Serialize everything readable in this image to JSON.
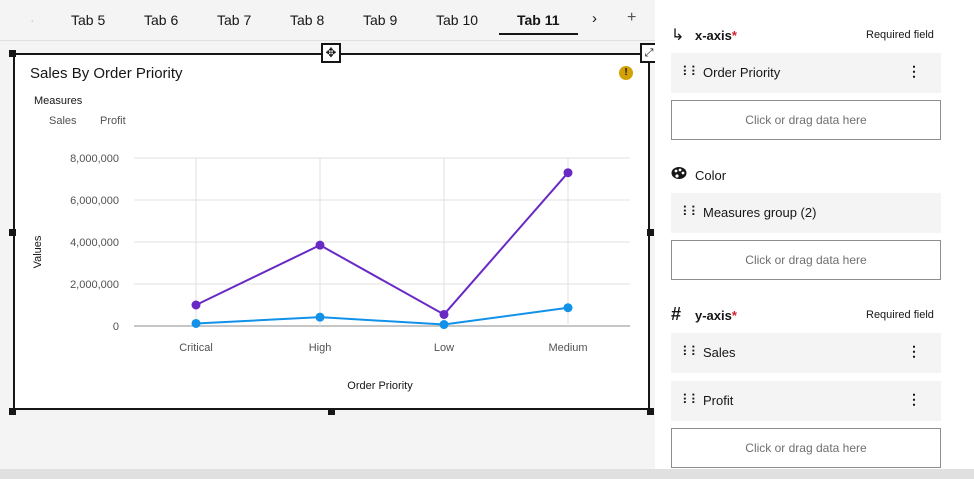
{
  "tabs": {
    "items": [
      "Tab 5",
      "Tab 6",
      "Tab 7",
      "Tab 8",
      "Tab 9",
      "Tab 10",
      "Tab 11"
    ],
    "active": "Tab 11",
    "next_icon": "chevron-right-icon",
    "add_icon": "plus-icon"
  },
  "chart_card": {
    "title": "Sales By Order Priority",
    "warning_icon": "warning-icon",
    "legend_title": "Measures",
    "legend_items": [
      "Sales",
      "Profit"
    ]
  },
  "chart_data": {
    "type": "line",
    "title": "Sales By Order Priority",
    "xlabel": "Order Priority",
    "ylabel": "Values",
    "categories": [
      "Critical",
      "High",
      "Low",
      "Medium"
    ],
    "ylim": [
      0,
      8000000
    ],
    "yticks": [
      0,
      2000000,
      4000000,
      6000000,
      8000000
    ],
    "ytick_labels": [
      "0",
      "2,000,000",
      "4,000,000",
      "6,000,000",
      "8,000,000"
    ],
    "grid": true,
    "series": [
      {
        "name": "Sales",
        "color": "#6929c4",
        "values": [
          1000000,
          3850000,
          550000,
          7300000
        ]
      },
      {
        "name": "Profit",
        "color": "#1192e8",
        "values": [
          120000,
          420000,
          70000,
          870000
        ]
      }
    ]
  },
  "panel": {
    "xaxis": {
      "icon": "xaxis-icon",
      "label": "x-axis",
      "star": "*",
      "required_text": "Required field",
      "fields": [
        "Order Priority"
      ],
      "drop_text": "Click or drag data here"
    },
    "color": {
      "icon": "palette-icon",
      "label": "Color",
      "fields": [
        "Measures group (2)"
      ],
      "drop_text": "Click or drag data here"
    },
    "yaxis": {
      "icon": "hash-icon",
      "label": "y-axis",
      "star": "*",
      "required_text": "Required field",
      "fields": [
        "Sales",
        "Profit"
      ],
      "drop_text": "Click or drag data here"
    }
  }
}
